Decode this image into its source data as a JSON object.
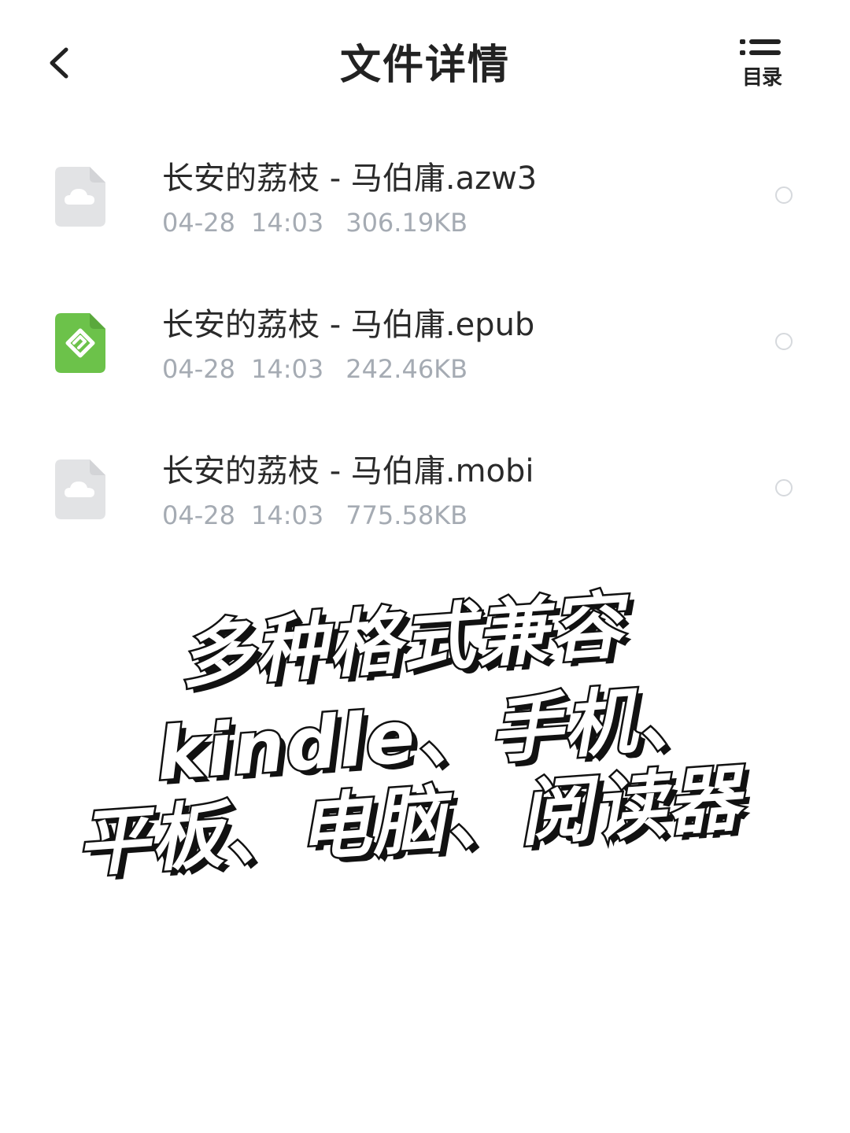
{
  "header": {
    "title": "文件详情",
    "back_icon": "chevron-left-icon",
    "toc_icon": "list-icon",
    "toc_label": "目录"
  },
  "files": [
    {
      "name": "长安的荔枝 - 马伯庸.azw3",
      "date": "04-28",
      "time": "14:03",
      "size": "306.19KB",
      "icon": "cloud-file-icon",
      "icon_color": "#e2e3e5",
      "selected": false
    },
    {
      "name": "长安的荔枝 - 马伯庸.epub",
      "date": "04-28",
      "time": "14:03",
      "size": "242.46KB",
      "icon": "epub-file-icon",
      "icon_color": "#6cc24a",
      "selected": false
    },
    {
      "name": "长安的荔枝 - 马伯庸.mobi",
      "date": "04-28",
      "time": "14:03",
      "size": "775.58KB",
      "icon": "cloud-file-icon",
      "icon_color": "#e2e3e5",
      "selected": false
    }
  ],
  "caption": {
    "line1": "多种格式兼容",
    "line2": "kindle、手机、",
    "line3": "平板、电脑、阅读器"
  },
  "colors": {
    "meta_text": "#a5abb3",
    "title_text": "#222222",
    "caption_fill": "#ffffff",
    "caption_stroke": "#111111"
  }
}
